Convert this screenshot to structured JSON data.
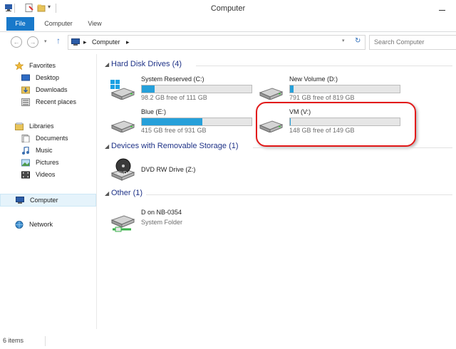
{
  "window": {
    "title": "Computer"
  },
  "ribbon": {
    "tabs": [
      "File",
      "Computer",
      "View"
    ]
  },
  "address": {
    "crumb": "Computer",
    "sep1": "▸",
    "sep2": "▸",
    "search_placeholder": "Search Computer"
  },
  "nav": {
    "favorites": "Favorites",
    "desktop": "Desktop",
    "downloads": "Downloads",
    "recent": "Recent places",
    "libraries": "Libraries",
    "documents": "Documents",
    "music": "Music",
    "pictures": "Pictures",
    "videos": "Videos",
    "computer": "Computer",
    "network": "Network"
  },
  "groups": {
    "hdd": "Hard Disk Drives (4)",
    "removable": "Devices with Removable Storage (1)",
    "other": "Other (1)"
  },
  "drives": [
    {
      "name": "System Reserved (C:)",
      "free": "98.2 GB free of 111 GB",
      "used_fraction": 0.12
    },
    {
      "name": "New Volume (D:)",
      "free": "791 GB free of 819 GB",
      "used_fraction": 0.035
    },
    {
      "name": "Blue (E:)",
      "free": "415 GB free of 931 GB",
      "used_fraction": 0.555
    },
    {
      "name": "VM (V:)",
      "free": "148 GB free of 149 GB",
      "used_fraction": 0.007
    }
  ],
  "removable": {
    "name": "DVD RW Drive (Z:)",
    "badge": "DVD"
  },
  "other_item": {
    "name": "D on NB-0354",
    "type": "System Folder"
  },
  "status": {
    "items": "6 items"
  },
  "colors": {
    "accent": "#1979ca",
    "bar_fill": "#26a0da",
    "highlight": "#e21a1a",
    "group_heading": "#1e3287"
  }
}
